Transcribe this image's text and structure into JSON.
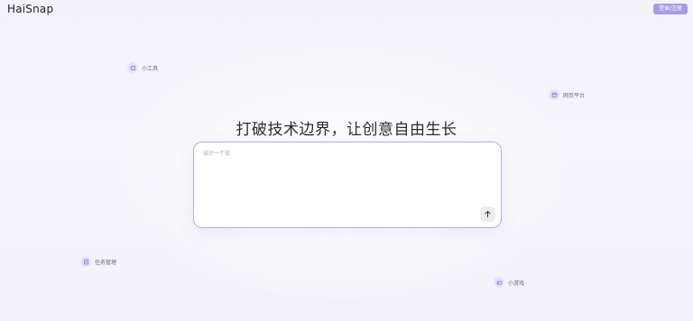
{
  "header": {
    "logo": "HaiSnap",
    "login_label": "登录/注册"
  },
  "tags": {
    "tools": "小工具",
    "web": "网页平台",
    "tasks": "任务管理",
    "games": "小游戏"
  },
  "main": {
    "headline": "打破技术边界，让创意自由生长",
    "input_placeholder": "设计一个说"
  },
  "colors": {
    "accent": "#a79be8",
    "border": "#b6adea"
  }
}
